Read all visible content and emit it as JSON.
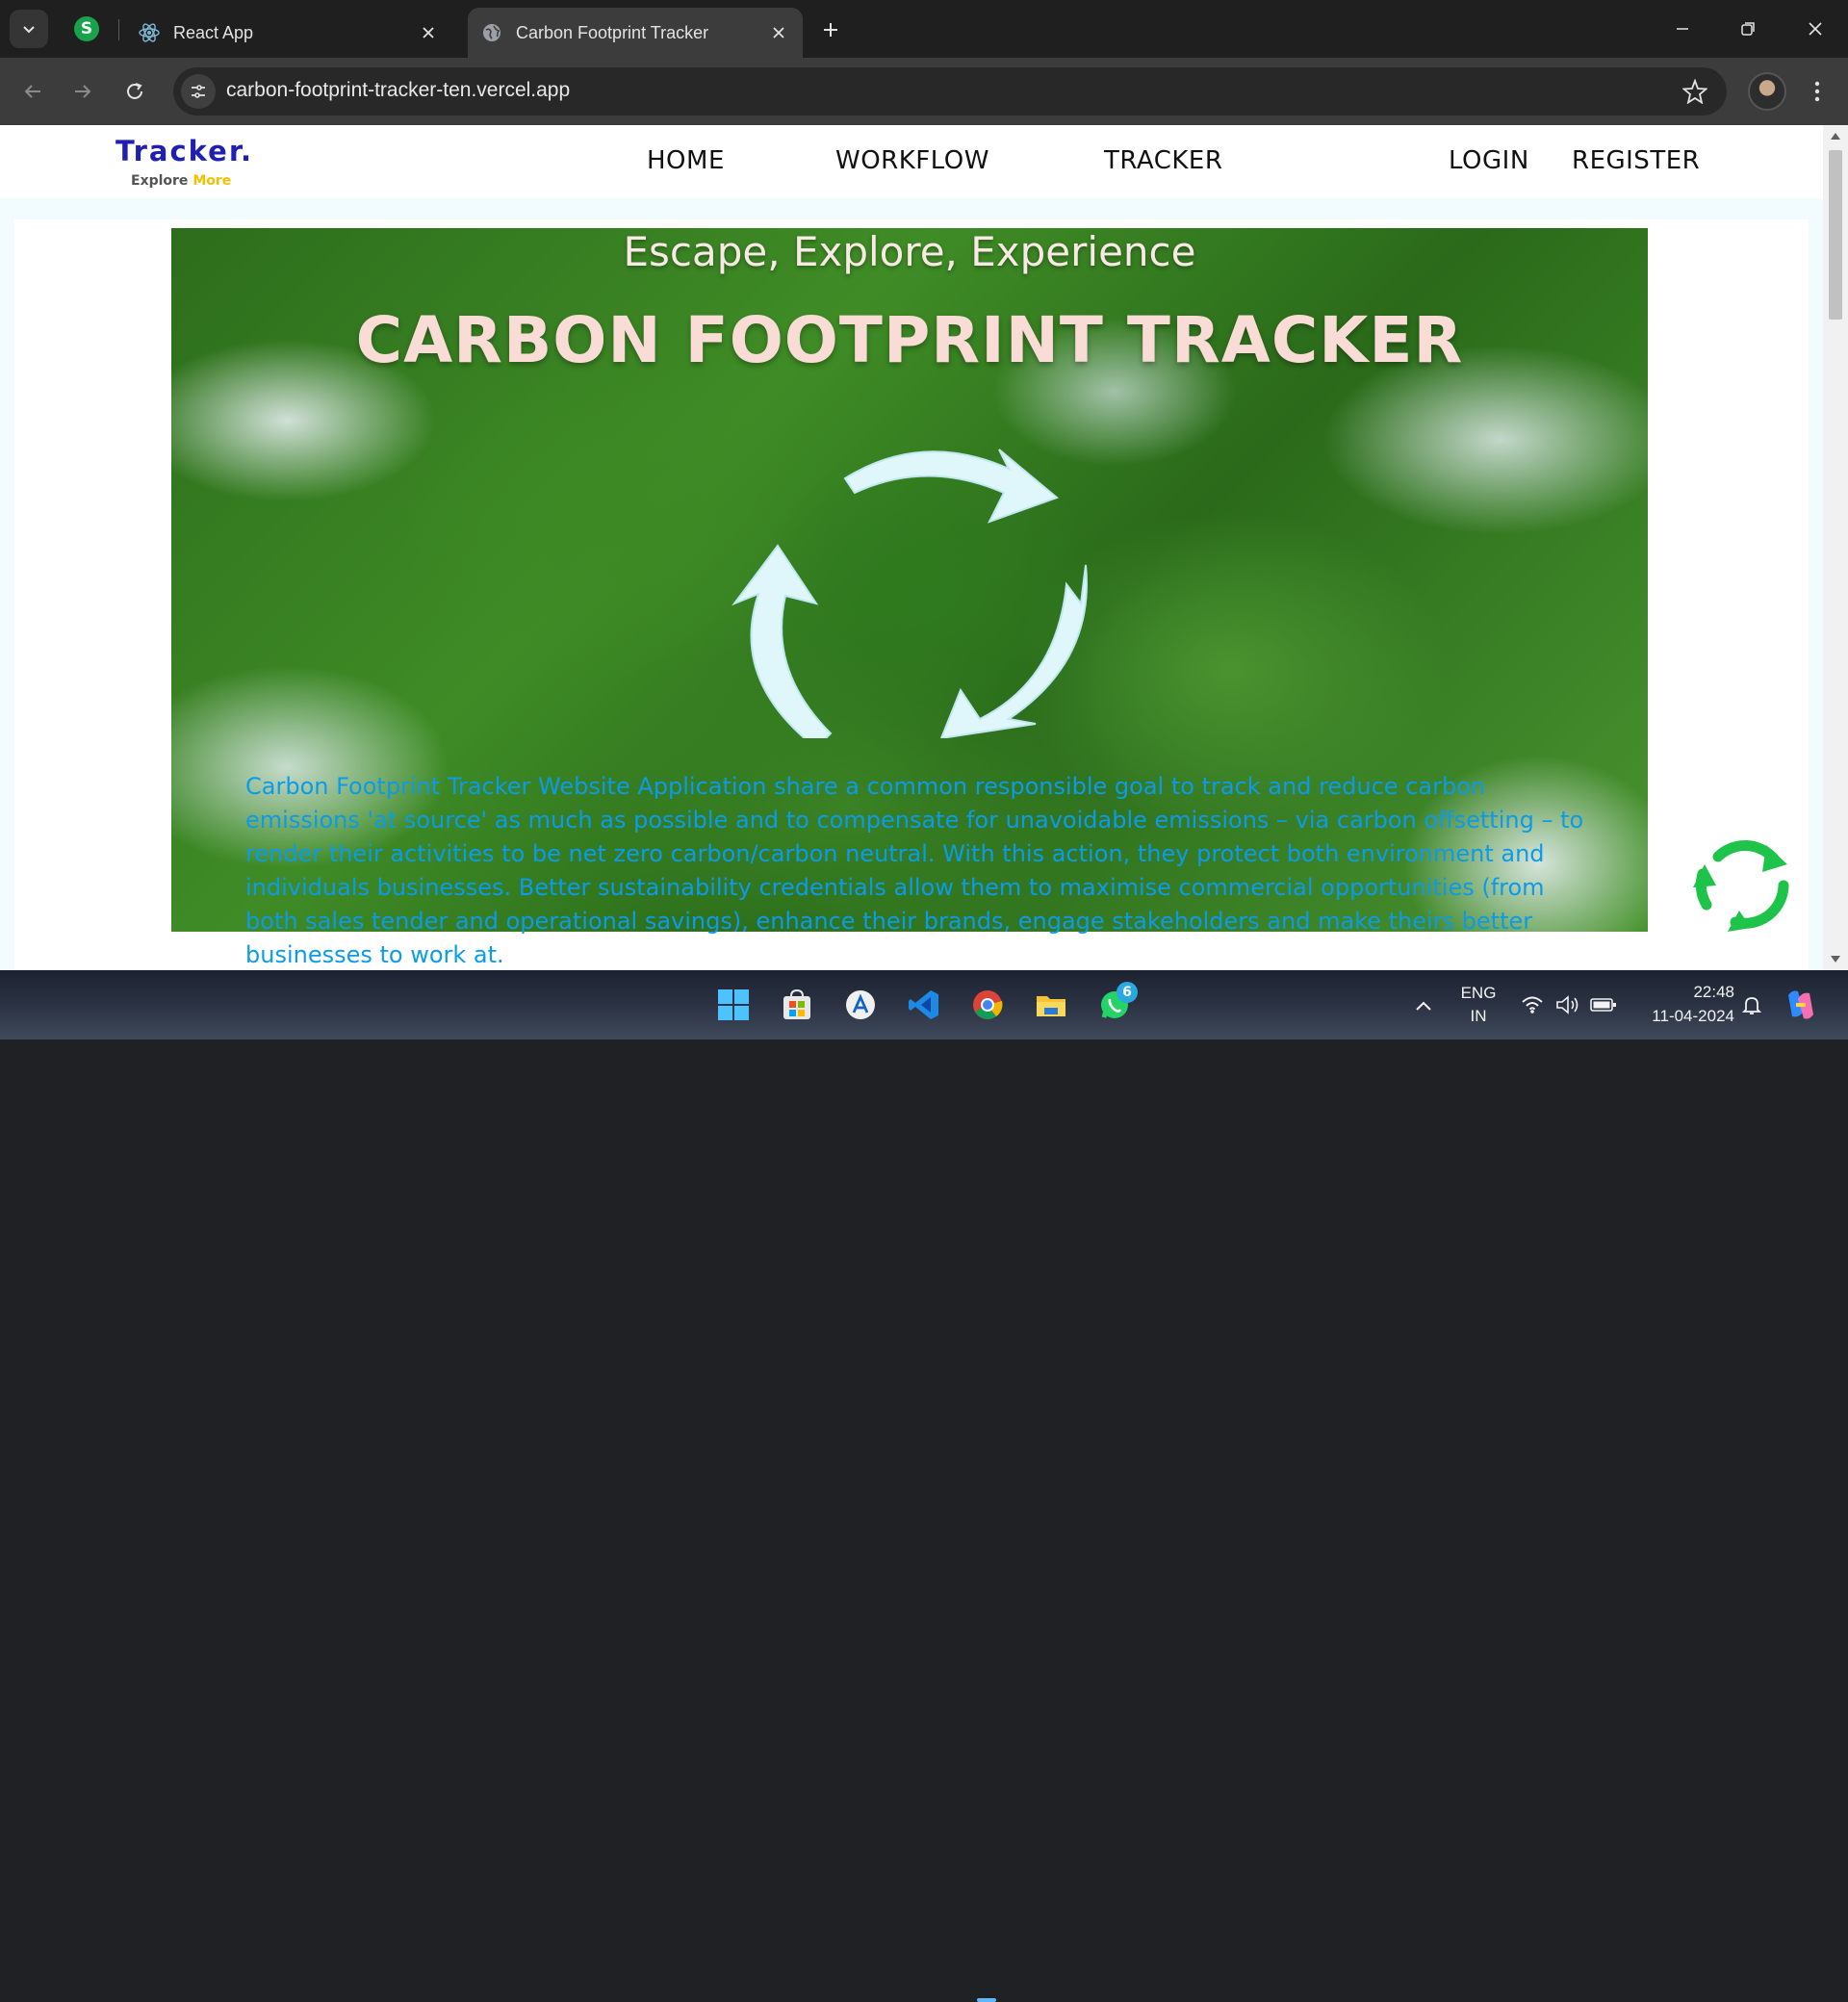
{
  "browser": {
    "tabs": [
      {
        "title": "React App",
        "favicon": "react-icon"
      },
      {
        "title": "Carbon Footprint Tracker",
        "favicon": "globe-icon",
        "active": true
      }
    ],
    "pinned_tab_letter": "S",
    "url": "carbon-footprint-tracker-ten.vercel.app"
  },
  "site": {
    "logo": {
      "title": "Tracker.",
      "sub_a": "Explore",
      "sub_b": "More"
    },
    "nav": {
      "home": "HOME",
      "workflow": "WORKFLOW",
      "tracker": "TRACKER",
      "login": "LOGIN",
      "register": "REGISTER"
    },
    "hero": {
      "tagline": "Escape, Explore, Experience",
      "title": "CARBON FOOTPRINT TRACKER",
      "description": "Carbon Footprint Tracker Website Application share a common responsible goal to track and reduce carbon emissions 'at source' as much as possible and to compensate for unavoidable emissions – via carbon offsetting – to render their activities to be net zero carbon/carbon neutral. With this action, they protect both environment and individuals businesses. Better sustainability credentials allow them to maximise commercial opportunities (from both sales tender and operational savings), enhance their brands, engage stakeholders and make theirs better businesses to work at."
    },
    "colors": {
      "logo": "#1f1fb4",
      "logo_more": "#f2c200",
      "description": "#0b9bea",
      "title": "#f9dcd5",
      "recycle": "#1ec44a"
    }
  },
  "taskbar": {
    "whatsapp_badge": "6",
    "language": "ENG",
    "region": "IN",
    "time": "22:48",
    "date": "11-04-2024"
  }
}
